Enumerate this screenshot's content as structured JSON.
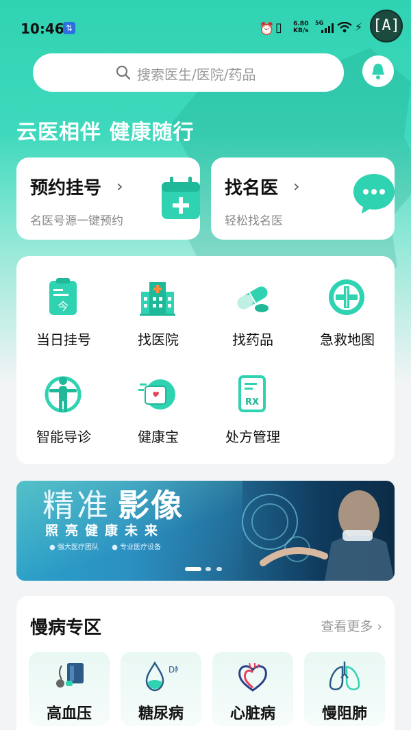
{
  "status_bar": {
    "time": "10:46",
    "net_speed_value": "6.80",
    "net_speed_unit": "KB/s",
    "network_type": "5G",
    "a_button_label": "[A]"
  },
  "search": {
    "placeholder": "搜索医生/医院/药品"
  },
  "slogan": "云医相伴  健康随行",
  "cards": {
    "appointment": {
      "title": "预约挂号",
      "subtitle": "名医号源一键预约"
    },
    "find_doctor": {
      "title": "找名医",
      "subtitle": "轻松找名医"
    }
  },
  "services": [
    {
      "label": "当日挂号",
      "icon": "clipboard-today-icon"
    },
    {
      "label": "找医院",
      "icon": "hospital-icon"
    },
    {
      "label": "找药品",
      "icon": "pill-icon"
    },
    {
      "label": "急救地图",
      "icon": "emergency-icon"
    },
    {
      "label": "智能导诊",
      "icon": "person-target-icon"
    },
    {
      "label": "健康宝",
      "icon": "health-folder-icon"
    },
    {
      "label": "处方管理",
      "icon": "prescription-icon"
    }
  ],
  "banner": {
    "title_part1": "精准",
    "title_part2": "影像",
    "subtitle": "照亮健康未来",
    "bullet1": "● 强大医疗团队",
    "bullet2": "● 专业医疗设备"
  },
  "chronic": {
    "title": "慢病专区",
    "more": "查看更多 ›",
    "items": [
      {
        "label": "高血压",
        "icon": "blood-pressure-icon"
      },
      {
        "label": "糖尿病",
        "icon": "diabetes-drop-icon"
      },
      {
        "label": "心脏病",
        "icon": "heart-icon"
      },
      {
        "label": "慢阻肺",
        "icon": "lungs-icon"
      }
    ]
  },
  "colors": {
    "primary": "#2fd3b2",
    "accent": "#1fb898"
  }
}
